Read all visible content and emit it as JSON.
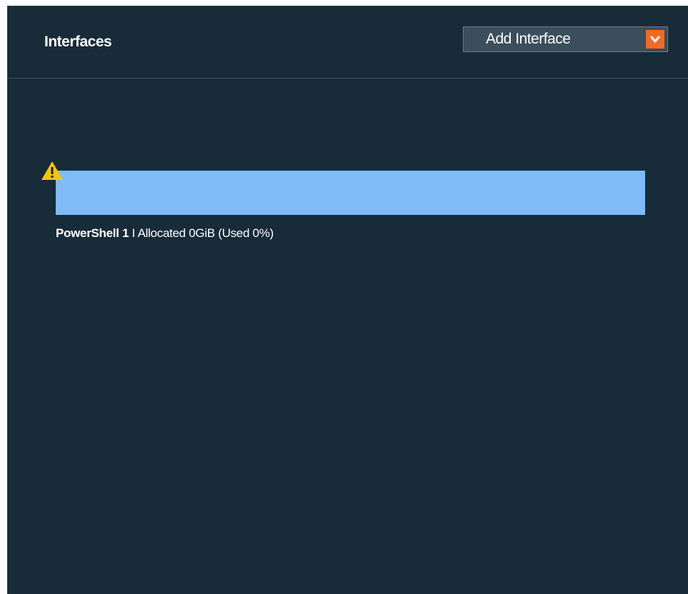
{
  "header": {
    "title": "Interfaces",
    "add_interface_label": "Add Interface"
  },
  "interfaces": [
    {
      "name": "PowerShell 1",
      "separator": "I",
      "allocation_text": "Allocated 0GiB (Used 0%)",
      "used_fraction": 0,
      "warning": true
    }
  ],
  "icons": {
    "dropdown": "chevron-down-icon",
    "warning": "warning-icon"
  },
  "colors": {
    "panel_background": "#172b39",
    "bar_color": "#7fbbf7",
    "accent": "#f26a22",
    "warning": "#f5c400"
  }
}
